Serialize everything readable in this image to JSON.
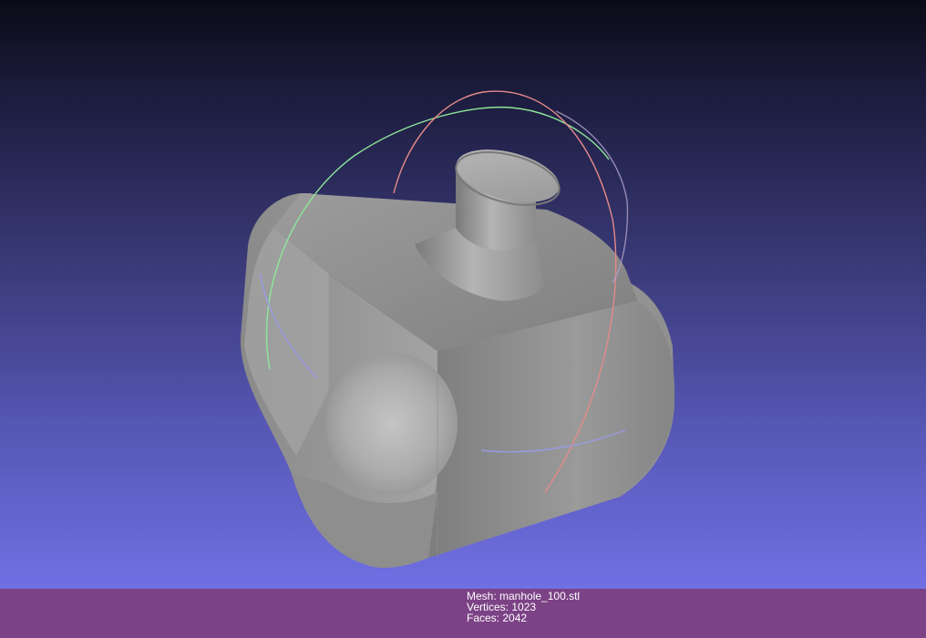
{
  "viewer": {
    "background_top": "#0b0b17",
    "background_bottom": "#7070e4",
    "mesh_color": "#9a9a9a",
    "trackball_colors": {
      "x_ring": "#e58a8a",
      "y_ring": "#8ee89a",
      "z_ring": "#9a9ae6"
    }
  },
  "info": {
    "bar_color": "#7c4286",
    "mesh_label": "Mesh: manhole_100.stl",
    "vertices_label": "Vertices: 1023",
    "faces_label": "Faces: 2042"
  }
}
